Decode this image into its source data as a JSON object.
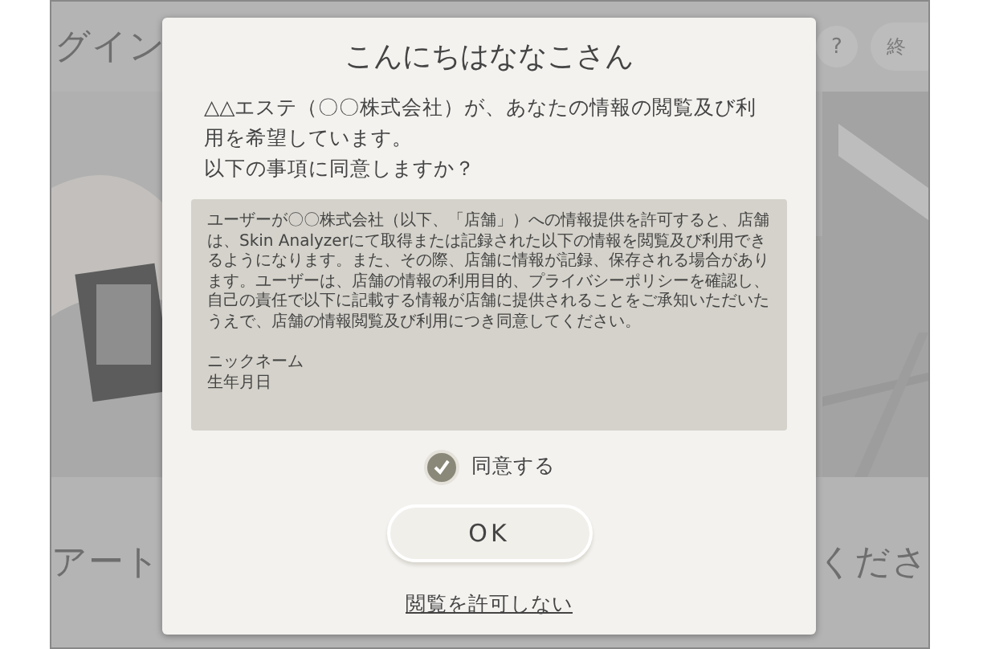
{
  "background": {
    "title": "グイン",
    "help_button": "?",
    "end_button": "終",
    "instruction_left": "アート",
    "instruction_right": "くださ"
  },
  "dialog": {
    "title": "こんにちはななこさん",
    "message": [
      "△△エステ（〇〇株式会社）が、あなたの情報の閲覧及び利用を希望しています。",
      "以下の事項に同意しますか？"
    ],
    "terms": {
      "paragraph": "ユーザーが〇〇株式会社（以下、「店舗」）への情報提供を許可すると、店舗は、Skin Analyzerにて取得または記録された以下の情報を閲覧及び利用できるようになります。また、その際、店舗に情報が記録、保存される場合があります。ユーザーは、店舗の情報の利用目的、プライバシーポリシーを確認し、自己の責任で以下に記載する情報が店舗に提供されることをご承知いただいたうえで、店舗の情報閲覧及び利用につき同意してください。",
      "items": [
        "ニックネーム",
        "生年月日"
      ]
    },
    "agree": {
      "label": "同意する",
      "checked": true
    },
    "ok_button": "OK",
    "decline_link": "閲覧を許可しない"
  }
}
